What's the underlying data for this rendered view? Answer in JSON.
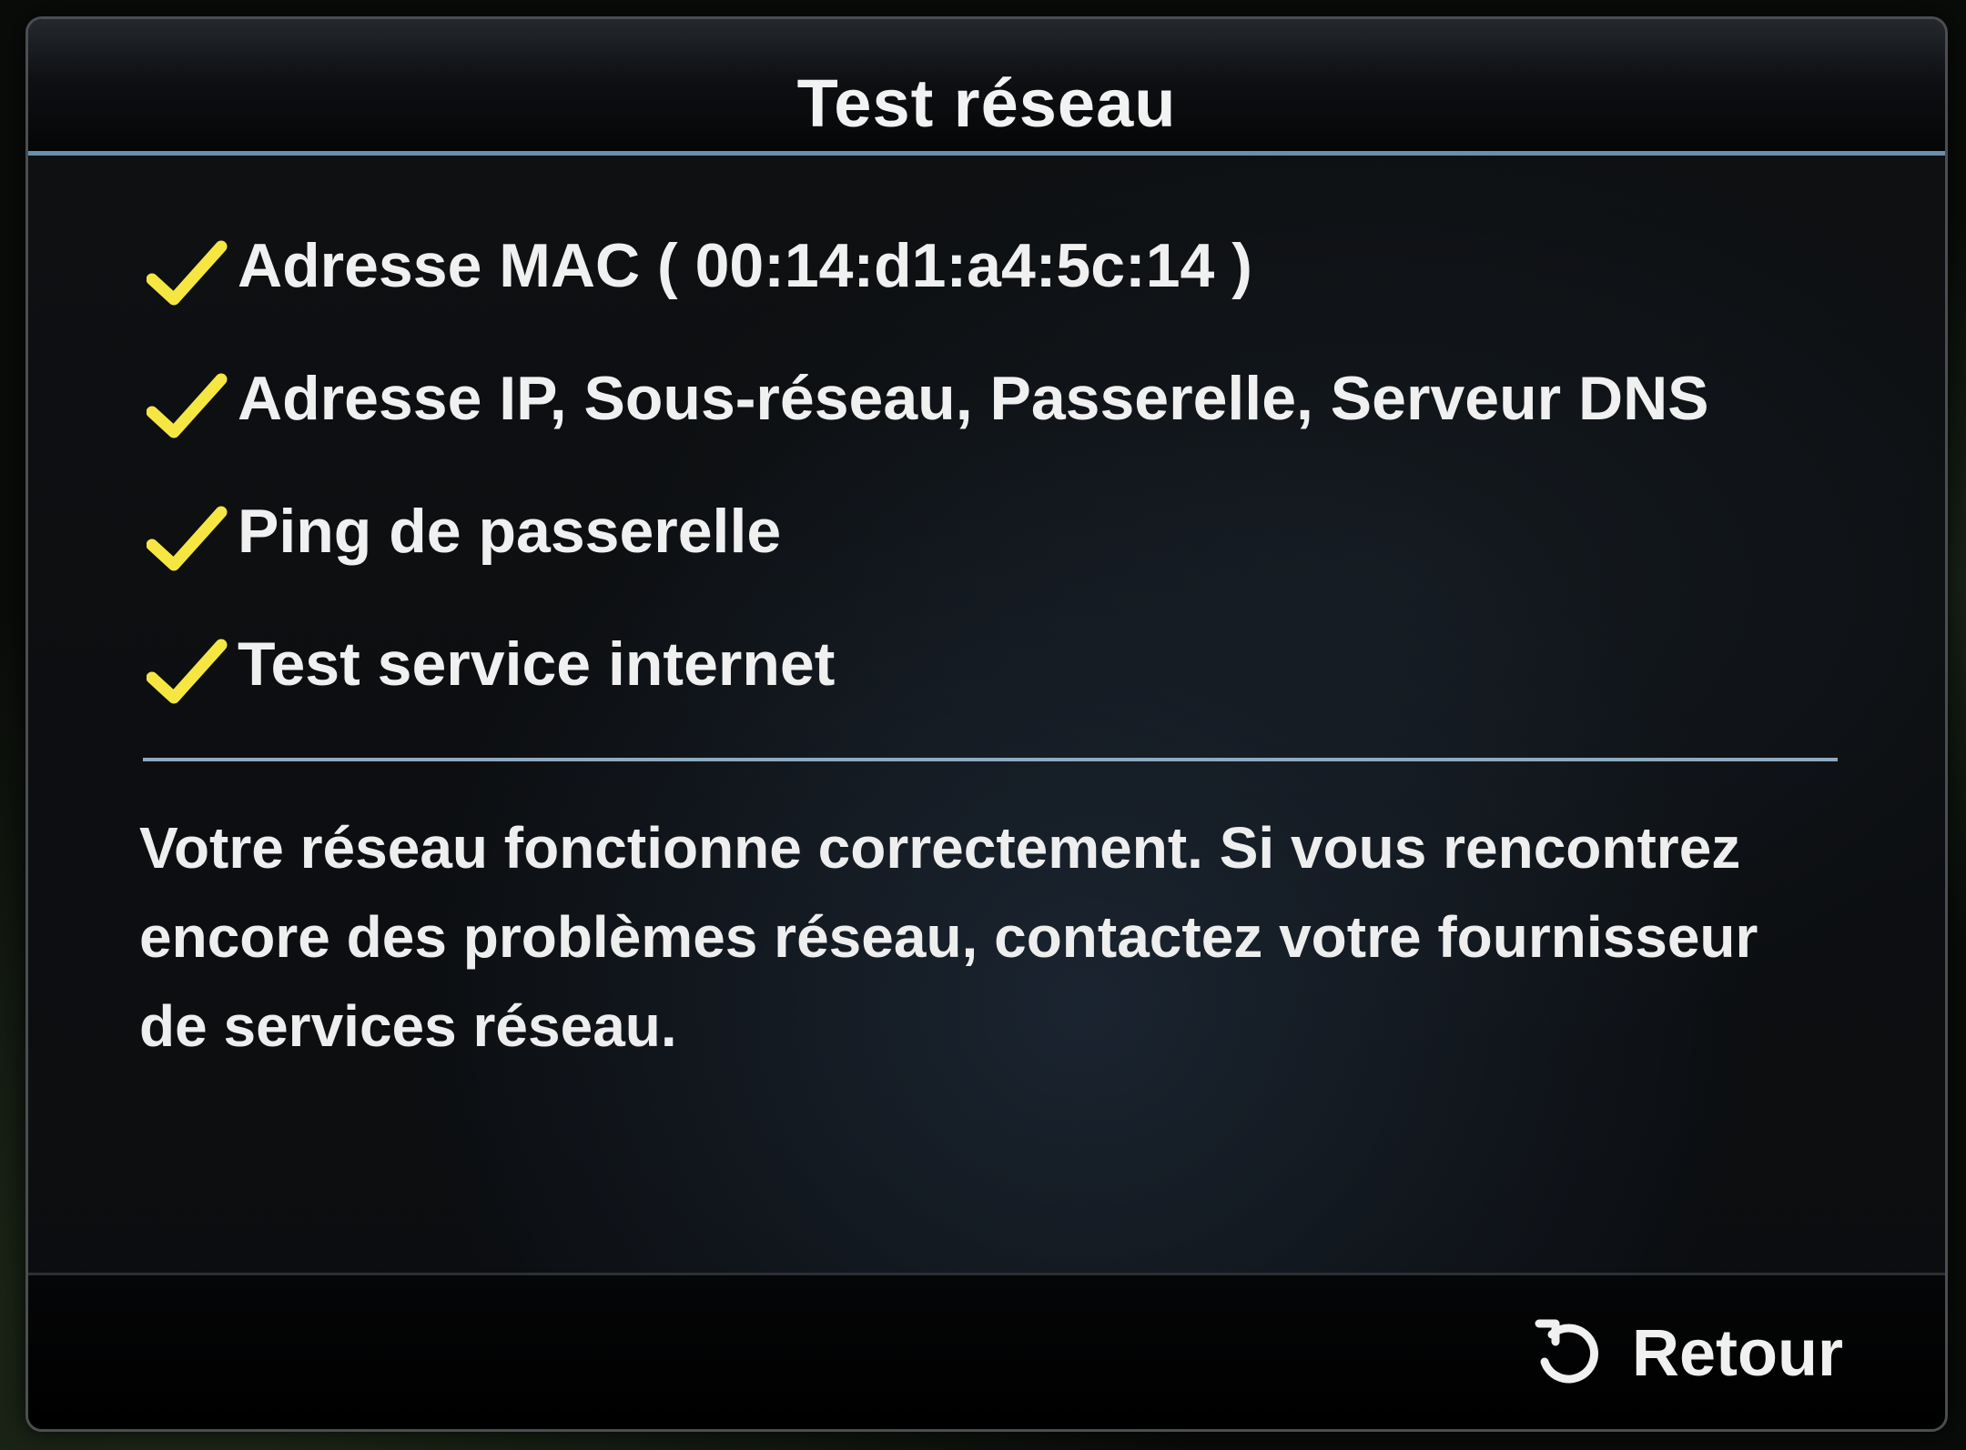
{
  "dialog": {
    "title": "Test réseau",
    "checks": [
      {
        "label": "Adresse MAC ( 00:14:d1:a4:5c:14 )",
        "status": "passed",
        "icon": "checkmark-icon"
      },
      {
        "label": "Adresse IP, Sous-réseau, Passerelle, Serveur DNS",
        "status": "passed",
        "icon": "checkmark-icon"
      },
      {
        "label": "Ping de passerelle",
        "status": "passed",
        "icon": "checkmark-icon"
      },
      {
        "label": "Test service internet",
        "status": "passed",
        "icon": "checkmark-icon"
      }
    ],
    "message": "Votre réseau fonctionne correctement. Si vous rencontrez encore des problèmes réseau, contactez votre fournisseur de services réseau.",
    "footer": {
      "return_label": "Retour",
      "return_icon": "return-arrow-icon"
    }
  },
  "colors": {
    "check_color": "#f5e642",
    "accent_line": "#6b8fae",
    "text": "#f0f0f0"
  }
}
